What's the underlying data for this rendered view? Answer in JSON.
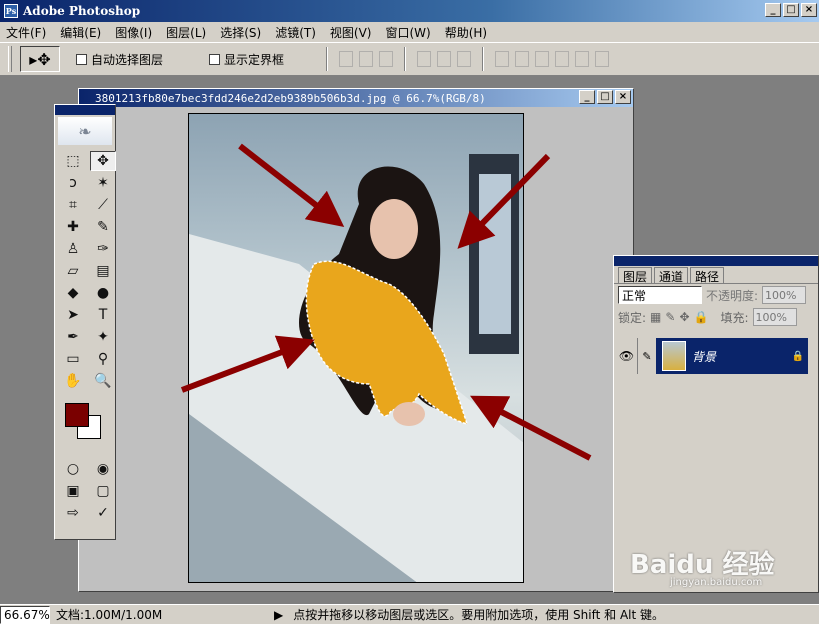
{
  "window": {
    "title": "Adobe Photoshop",
    "min": "_",
    "max": "□",
    "close": "×"
  },
  "menu": [
    "文件(F)",
    "编辑(E)",
    "图像(I)",
    "图层(L)",
    "选择(S)",
    "滤镜(T)",
    "视图(V)",
    "窗口(W)",
    "帮助(H)"
  ],
  "options": {
    "auto_select": "自动选择图层",
    "show_bounds": "显示定界框"
  },
  "document": {
    "title": "3801213fb80e7bec3fdd246e2d2eb9389b506b3d.jpg @ 66.7%(RGB/8)"
  },
  "colors": {
    "foreground": "#7a0000",
    "background": "#ffffff",
    "arrow": "#8b0000"
  },
  "layers_panel": {
    "tabs": [
      "图层",
      "通道",
      "路径"
    ],
    "blend_mode": "正常",
    "opacity_label": "不透明度:",
    "opacity_value": "100%",
    "lock_label": "锁定:",
    "fill_label": "填充:",
    "fill_value": "100%",
    "layer_name": "背景"
  },
  "status": {
    "zoom": "66.67%",
    "doc": "文档:1.00M/1.00M",
    "hint": "点按并拖移以移动图层或选区。要用附加选项，使用 Shift 和 Alt 键。"
  },
  "watermark": {
    "main": "Baidu 经验",
    "sub": "jingyan.baidu.com"
  }
}
